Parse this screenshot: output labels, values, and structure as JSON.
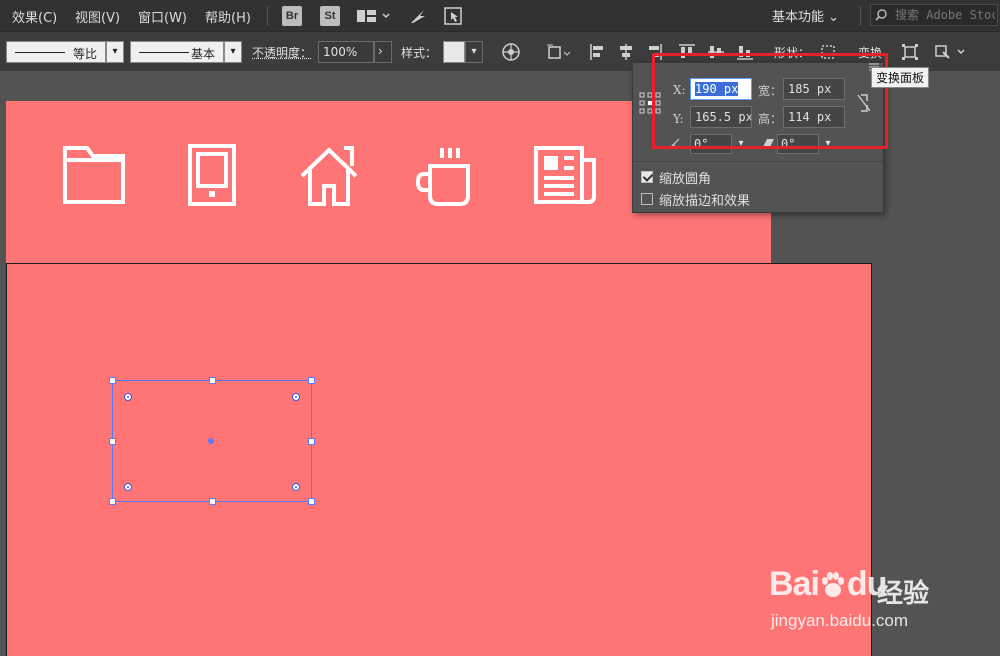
{
  "menubar": {
    "items": [
      "效果(C)",
      "视图(V)",
      "窗口(W)",
      "帮助(H)"
    ],
    "bridge_label": "Br",
    "stock_label": "St",
    "workspace": "基本功能",
    "search_placeholder": "搜索 Adobe Stock"
  },
  "controlbar": {
    "stroke_profile": "等比",
    "brush": "基本",
    "opacity_label": "不透明度：",
    "opacity_value": "100%",
    "style_label": "样式：",
    "shape_label": "形状：",
    "transform_label": "变换"
  },
  "transform_panel": {
    "x_label": "X:",
    "x_value": "190 px",
    "w_label": "宽：",
    "w_value": "185 px",
    "y_label": "Y:",
    "y_value": "165.5 px",
    "h_label": "高：",
    "h_value": "114 px",
    "rotate_value": "0°",
    "shear_value": "0°",
    "scale_corners_label": "缩放圆角",
    "scale_corners_checked": true,
    "scale_strokes_label": "缩放描边和效果",
    "scale_strokes_checked": false
  },
  "tooltip": "变换面板",
  "artboard_icons": [
    "folder-icon",
    "phone-icon",
    "home-icon",
    "coffee-cup-icon",
    "newspaper-icon"
  ],
  "colors": {
    "artboard": "#ff7575",
    "selection": "#5a7bff",
    "highlight": "#e8202a",
    "ui_dark": "#323232"
  },
  "watermark": {
    "brand": "Bai",
    "brand_suffix": "du",
    "cn": "经验",
    "url": "jingyan.baidu.com"
  }
}
